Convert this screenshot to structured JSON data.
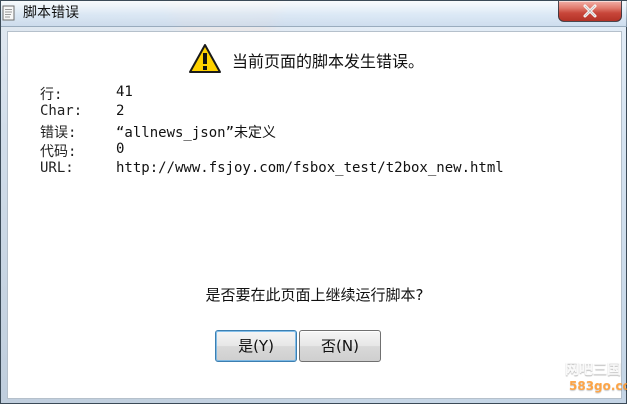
{
  "window": {
    "title": "脚本错误"
  },
  "dialog": {
    "message": "当前页面的脚本发生错误。",
    "details": [
      {
        "label": "行:",
        "value": "41"
      },
      {
        "label": "Char:",
        "value": "2"
      },
      {
        "label": "错误:",
        "value": "“allnews_json”未定义"
      },
      {
        "label": "代码:",
        "value": "0"
      },
      {
        "label": "URL:",
        "value": "http://www.fsjoy.com/fsbox_test/t2box_new.html"
      }
    ],
    "question": "是否要在此页面上继续运行脚本?",
    "buttons": {
      "yes": "是(Y)",
      "no": "否(N)"
    }
  },
  "watermark": {
    "title": "网吧三国",
    "site": "583go.com"
  },
  "icons": {
    "app": "script-error-icon",
    "close": "close-icon",
    "warning": "warning-icon",
    "watermark": "watermark-logo-icon"
  },
  "colors": {
    "close_button": "#c8463a",
    "warning_yellow": "#ffd200"
  }
}
